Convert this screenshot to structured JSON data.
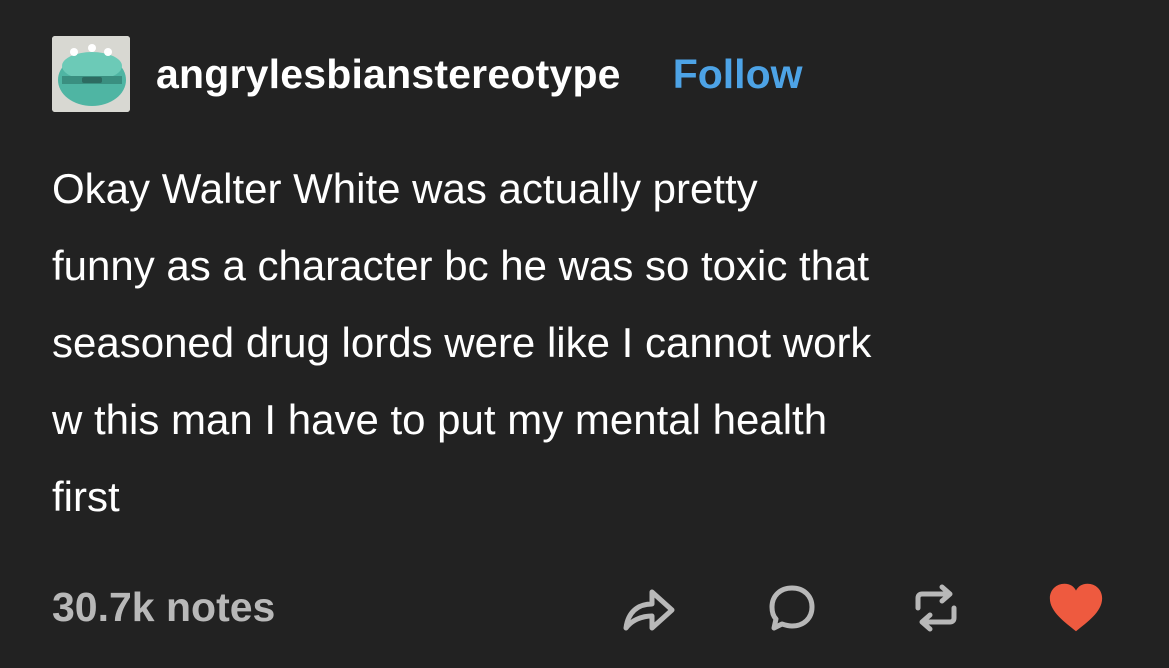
{
  "post": {
    "username": "angrylesbianstereotype",
    "follow_label": "Follow",
    "body_lines": [
      "Okay Walter White was actually pretty",
      "funny as a character bc he was so toxic that",
      "seasoned drug lords were like I cannot work",
      "w this man I have to put my mental health",
      "first"
    ],
    "notes": "30.7k notes"
  },
  "actions": {
    "share_icon": "share-arrow-icon",
    "reply_icon": "speech-bubble-icon",
    "reblog_icon": "reblog-icon",
    "like_icon": "heart-icon"
  },
  "colors": {
    "background": "#222222",
    "text": "#ffffff",
    "follow": "#4da3e6",
    "notes": "#b8b8b8",
    "icons": "#b8b8b8",
    "heart": "#ee5a3f"
  }
}
